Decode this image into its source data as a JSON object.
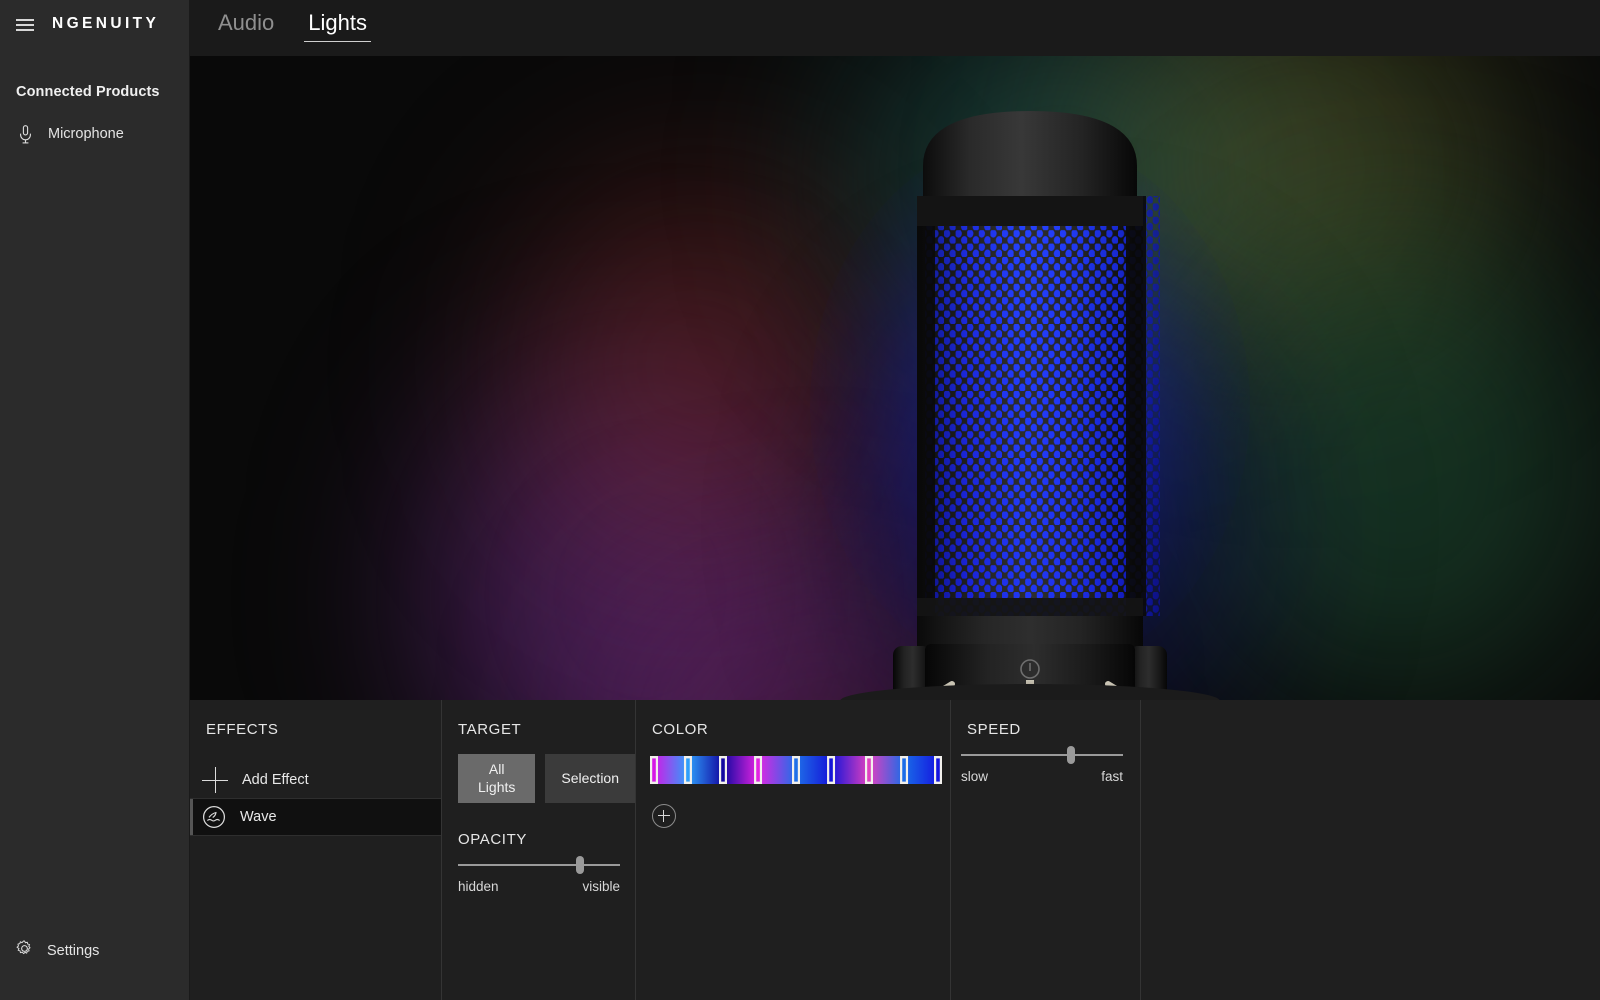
{
  "app": {
    "brand": "NGENUITY",
    "menu_icon": "hamburger-icon"
  },
  "sidebar": {
    "section_title": "Connected Products",
    "items": [
      {
        "label": "Microphone",
        "icon": "microphone-icon"
      }
    ],
    "settings": {
      "label": "Settings",
      "icon": "gear-icon"
    }
  },
  "tabs": [
    {
      "label": "Audio",
      "active": false
    },
    {
      "label": "Lights",
      "active": true
    }
  ],
  "preview": {
    "device": "microphone",
    "led_color": "#1a2ae8",
    "body_color": "#121212"
  },
  "panel": {
    "effects": {
      "title": "EFFECTS",
      "add_effect_label": "Add Effect",
      "add_effect_icon": "plus-icon",
      "items": [
        {
          "label": "Wave",
          "icon": "wave-icon",
          "selected": true
        }
      ]
    },
    "target": {
      "title": "TARGET",
      "options": [
        {
          "label": "All Lights",
          "selected": true
        },
        {
          "label": "Selection",
          "selected": false
        }
      ]
    },
    "opacity": {
      "title": "OPACITY",
      "min_label": "hidden",
      "max_label": "visible",
      "value_percent": 75
    },
    "color": {
      "title": "COLOR",
      "add_color_icon": "plus-circle-icon",
      "stops": [
        {
          "position_percent": 1,
          "color": "#d617e6"
        },
        {
          "position_percent": 13,
          "color": "#2f9ffb"
        },
        {
          "position_percent": 25,
          "color": "#1207a0"
        },
        {
          "position_percent": 37,
          "color": "#e224e2"
        },
        {
          "position_percent": 50,
          "color": "#1f6fe8"
        },
        {
          "position_percent": 62,
          "color": "#1414d8"
        },
        {
          "position_percent": 75,
          "color": "#e040c0"
        },
        {
          "position_percent": 87,
          "color": "#1a6ce8"
        },
        {
          "position_percent": 99,
          "color": "#1414e0"
        }
      ]
    },
    "speed": {
      "title": "SPEED",
      "min_label": "slow",
      "max_label": "fast",
      "value_percent": 68
    }
  },
  "theme": {
    "sidebar_bg": "#2b2b2b",
    "panel_bg": "#1f1f1f",
    "tabbar_bg": "#1a1a1a",
    "accent_text": "#ffffff",
    "muted_text": "#8f8f8f"
  }
}
